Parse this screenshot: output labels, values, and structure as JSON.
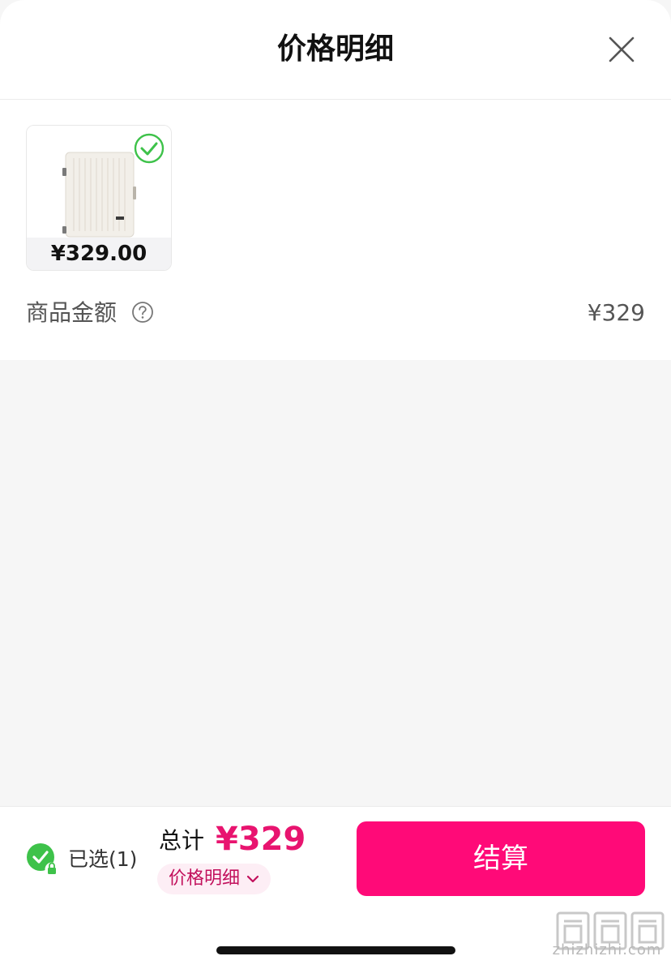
{
  "header": {
    "title": "价格明细",
    "close_icon": "close-icon"
  },
  "product": {
    "price": "¥329.00",
    "selected": true,
    "check_icon": "check-circle-icon",
    "image": "white-suitcase"
  },
  "summary": {
    "amount_label": "商品金额",
    "help_icon": "question-circle-icon",
    "amount_value": "¥329"
  },
  "footer": {
    "select_label": "已选(1)",
    "select_icon": "check-circle-lock-icon",
    "total_label": "总计",
    "total_value": "¥329",
    "detail_label": "价格明细",
    "detail_icon": "chevron-down-icon",
    "checkout_label": "结算"
  },
  "watermark": {
    "text": "zhizhizhi.com"
  },
  "colors": {
    "accent": "#ff0a78",
    "price_accent": "#e8146f",
    "check_green": "#3ec24a",
    "background": "#f6f6f6"
  }
}
